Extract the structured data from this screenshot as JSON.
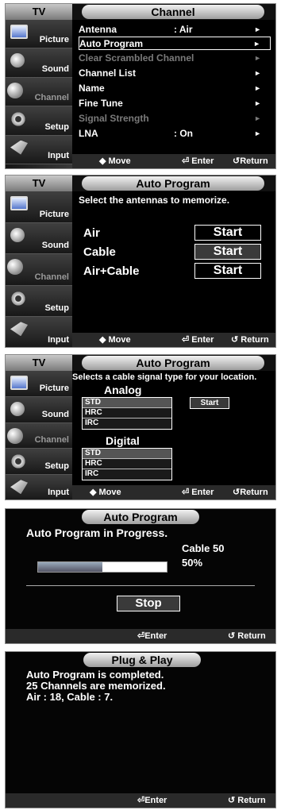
{
  "sidebar": {
    "tv_label": "TV",
    "items": [
      {
        "label": "Picture",
        "icon": "picture-icon"
      },
      {
        "label": "Sound",
        "icon": "sound-icon"
      },
      {
        "label": "Channel",
        "icon": "channel-icon"
      },
      {
        "label": "Setup",
        "icon": "setup-icon"
      },
      {
        "label": "Input",
        "icon": "input-icon"
      }
    ]
  },
  "screen1": {
    "title": "Channel",
    "menu": [
      {
        "label": "Antenna",
        "value": ": Air",
        "arrow": "►",
        "state": "normal"
      },
      {
        "label": "Auto Program",
        "value": "",
        "arrow": "►",
        "state": "selected"
      },
      {
        "label": "Clear Scrambled Channel",
        "value": "",
        "arrow": "►",
        "state": "disabled"
      },
      {
        "label": "Channel List",
        "value": "",
        "arrow": "►",
        "state": "normal"
      },
      {
        "label": "Name",
        "value": "",
        "arrow": "►",
        "state": "normal"
      },
      {
        "label": "Fine Tune",
        "value": "",
        "arrow": "►",
        "state": "normal"
      },
      {
        "label": "Signal Strength",
        "value": "",
        "arrow": "►",
        "state": "disabled"
      },
      {
        "label": "LNA",
        "value": ": On",
        "arrow": "►",
        "state": "normal"
      }
    ],
    "footer": {
      "move": "◆ Move",
      "enter": "Enter",
      "return": "Return"
    }
  },
  "screen2": {
    "title": "Auto Program",
    "instruction": "Select the antennas to memorize.",
    "options": [
      {
        "label": "Air",
        "button": "Start",
        "selected": false
      },
      {
        "label": "Cable",
        "button": "Start",
        "selected": true
      },
      {
        "label": "Air+Cable",
        "button": "Start",
        "selected": false
      }
    ],
    "footer": {
      "move": "◆ Move",
      "enter": "Enter",
      "return": "Return"
    }
  },
  "screen3": {
    "title": "Auto Program",
    "instruction": "Selects a cable signal type for your location.",
    "analog_label": "Analog",
    "analog_options": [
      "STD",
      "HRC",
      "IRC"
    ],
    "digital_label": "Digital",
    "digital_options": [
      "STD",
      "HRC",
      "IRC"
    ],
    "start_button": "Start",
    "footer": {
      "move": "◆ Move",
      "enter": "Enter",
      "return": "Return"
    }
  },
  "screen4": {
    "title": "Auto Program",
    "status": "Auto Program in Progress.",
    "channel": "Cable 50",
    "percent_text": "50%",
    "progress": 0.5,
    "stop_button": "Stop",
    "footer": {
      "enter": "Enter",
      "return": "Return"
    }
  },
  "screen5": {
    "title": "Plug & Play",
    "lines": [
      "Auto Program is completed.",
      "25 Channels are memorized.",
      "Air : 18, Cable : 7."
    ],
    "footer": {
      "enter": "Enter",
      "return": "Return"
    }
  },
  "colors": {
    "accent": "#ffffff",
    "background": "#000000",
    "pill": "#d0d0d0"
  }
}
